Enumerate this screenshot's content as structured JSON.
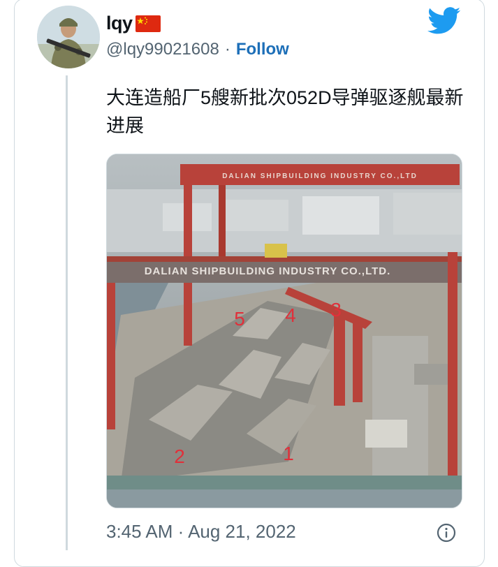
{
  "tweet": {
    "display_name": "lqy",
    "handle": "@lqy99021608",
    "separator": "·",
    "follow_label": "Follow",
    "text": "大连造船厂5艘新批次052D导弹驱逐舰最新进展",
    "timestamp": "3:45 AM · Aug 21, 2022"
  },
  "media": {
    "crane_sign_far": "DALIAN SHIPBUILDING INDUSTRY CO.,LTD",
    "crane_sign_near": "DALIAN SHIPBUILDING INDUSTRY CO.,LTD.",
    "labels": [
      "5",
      "4",
      "3",
      "2",
      "1"
    ]
  },
  "icons": {
    "twitter": "twitter-bird-icon",
    "flag": "china-flag-icon",
    "info": "info-icon"
  },
  "colors": {
    "twitter_blue": "#1d9bf0",
    "follow_blue": "#1d6fb8",
    "secondary_text": "#536471",
    "crane_red": "#b8423a",
    "annotation_red": "#e0303a"
  }
}
